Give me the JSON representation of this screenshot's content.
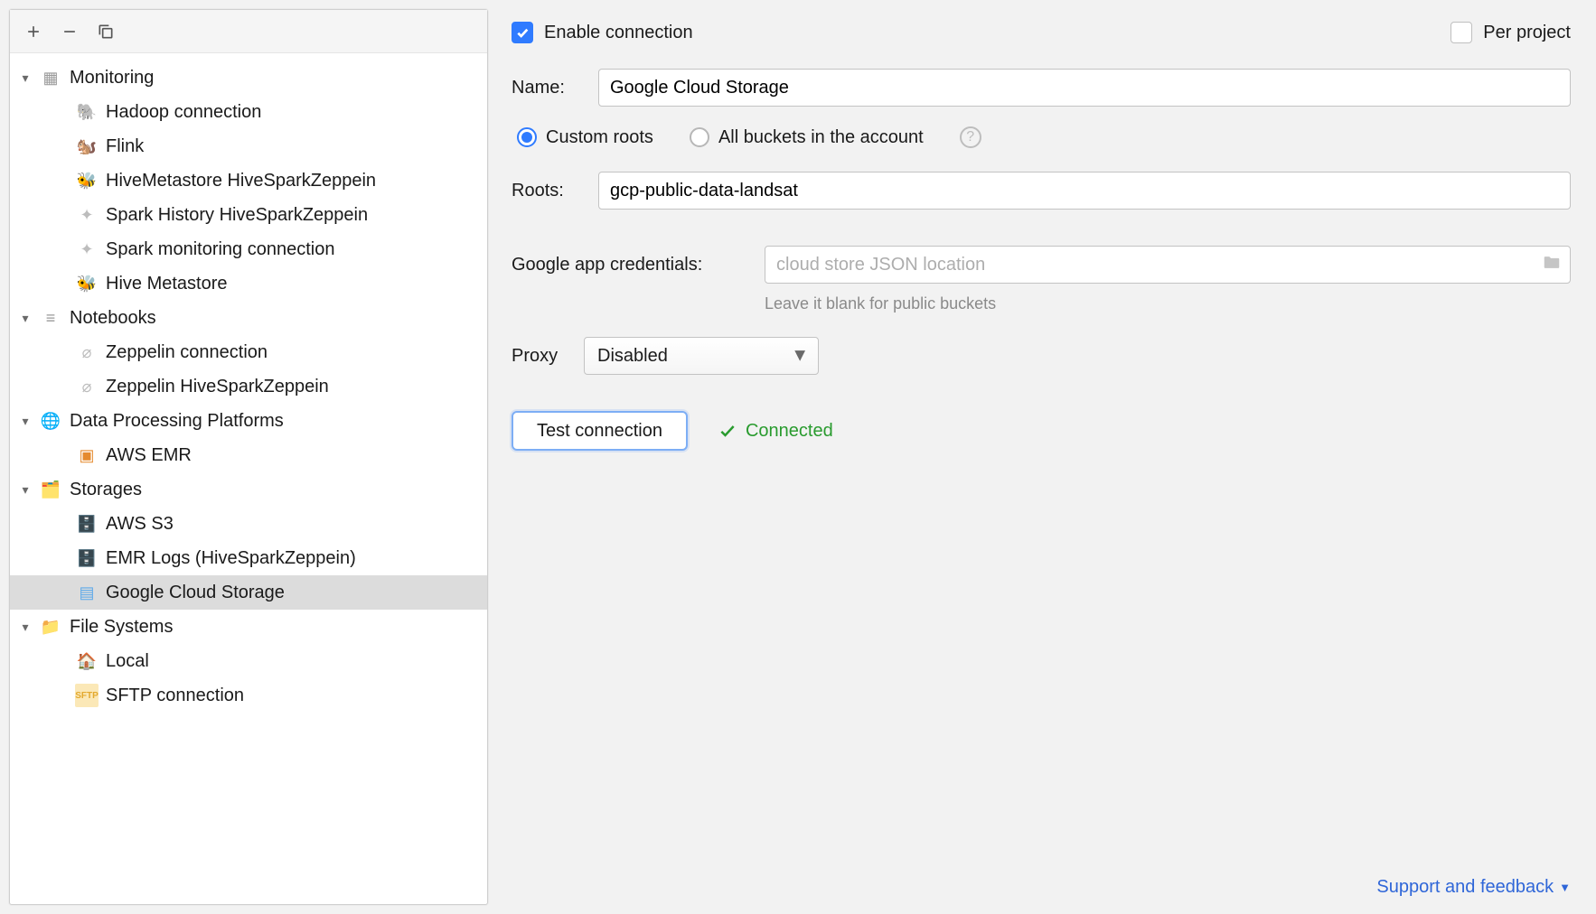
{
  "sidebar": {
    "groups": [
      {
        "label": "Monitoring",
        "icon": "table-icon",
        "items": [
          {
            "label": "Hadoop connection",
            "icon": "hadoop-icon"
          },
          {
            "label": "Flink",
            "icon": "flink-icon"
          },
          {
            "label": "HiveMetastore HiveSparkZeppein",
            "icon": "hive-bee-icon"
          },
          {
            "label": "Spark History HiveSparkZeppein",
            "icon": "spark-star-icon"
          },
          {
            "label": "Spark monitoring connection",
            "icon": "spark-star-icon"
          },
          {
            "label": "Hive Metastore",
            "icon": "hive-bee-icon"
          }
        ]
      },
      {
        "label": "Notebooks",
        "icon": "notebook-icon",
        "items": [
          {
            "label": "Zeppelin connection",
            "icon": "zeppelin-icon"
          },
          {
            "label": "Zeppelin HiveSparkZeppein",
            "icon": "zeppelin-icon"
          }
        ]
      },
      {
        "label": "Data Processing Platforms",
        "icon": "globe-icon",
        "items": [
          {
            "label": "AWS EMR",
            "icon": "aws-emr-icon"
          }
        ]
      },
      {
        "label": "Storages",
        "icon": "storage-folder-icon",
        "items": [
          {
            "label": "AWS S3",
            "icon": "aws-s3-icon"
          },
          {
            "label": "EMR Logs (HiveSparkZeppein)",
            "icon": "aws-s3-icon"
          },
          {
            "label": "Google Cloud Storage",
            "icon": "gcs-icon",
            "selected": true
          }
        ]
      },
      {
        "label": "File Systems",
        "icon": "folder-icon",
        "items": [
          {
            "label": "Local",
            "icon": "home-icon"
          },
          {
            "label": "SFTP connection",
            "icon": "sftp-icon"
          }
        ]
      }
    ]
  },
  "form": {
    "enable_connection": {
      "label": "Enable connection",
      "checked": true
    },
    "per_project": {
      "label": "Per project",
      "checked": false
    },
    "name_label": "Name:",
    "name_value": "Google Cloud Storage",
    "roots_mode": {
      "custom_label": "Custom roots",
      "all_label": "All buckets in the account",
      "selected": "custom"
    },
    "roots_label": "Roots:",
    "roots_value": "gcp-public-data-landsat",
    "credentials_label": "Google app credentials:",
    "credentials_placeholder": "cloud store JSON location",
    "credentials_value": "",
    "credentials_hint": "Leave it blank for public buckets",
    "proxy_label": "Proxy",
    "proxy_value": "Disabled",
    "test_button": "Test connection",
    "status_text": "Connected"
  },
  "footer": {
    "support_link": "Support and feedback"
  }
}
